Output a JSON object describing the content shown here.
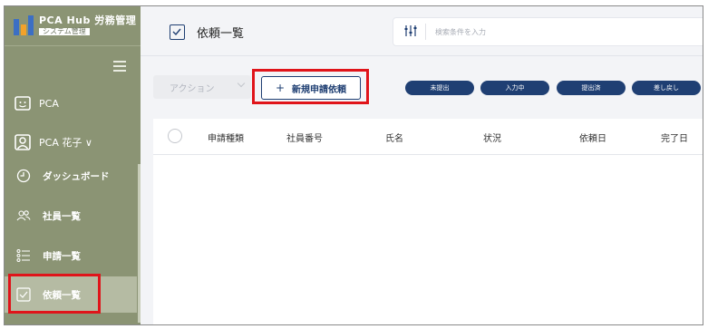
{
  "brand": {
    "title": "PCA Hub 労務管理",
    "subtitle": "システム管理"
  },
  "sidebar": {
    "org_label": "PCA",
    "user_label": "PCA 花子 ∨",
    "items": [
      {
        "label": "ダッシュボード",
        "icon": "clock-icon"
      },
      {
        "label": "社員一覧",
        "icon": "users-icon"
      },
      {
        "label": "申請一覧",
        "icon": "list-icon"
      },
      {
        "label": "依頼一覧",
        "icon": "checkbox-icon"
      }
    ]
  },
  "header": {
    "title": "依頼一覧",
    "search_placeholder": "検索条件を入力"
  },
  "toolbar": {
    "action_label": "アクション",
    "new_button_label": "新規申請依頼",
    "filters": [
      "未提出",
      "入力中",
      "提出済",
      "差し戻し"
    ]
  },
  "table": {
    "columns": [
      "申請種類",
      "社員番号",
      "氏名",
      "状況",
      "依頼日",
      "完了日"
    ],
    "rows": []
  },
  "colors": {
    "sidebar": "#8b9474",
    "accent": "#1f3f73",
    "highlight": "#e0141a"
  }
}
